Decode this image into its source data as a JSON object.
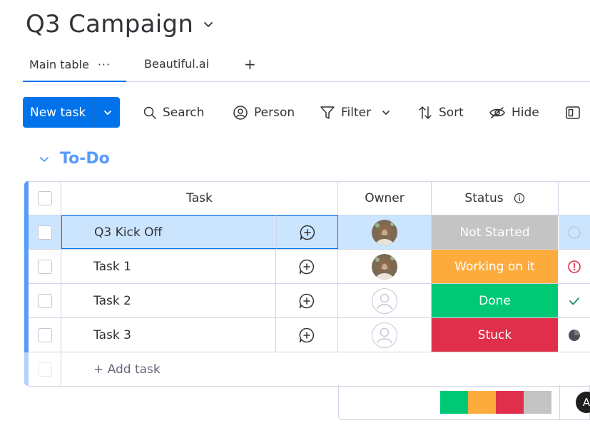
{
  "board": {
    "title": "Q3 Campaign"
  },
  "views": {
    "main": "Main table",
    "main_more": "···",
    "second": "Beautiful.ai",
    "add": "+"
  },
  "toolbar": {
    "new_task": "New task",
    "search": "Search",
    "person": "Person",
    "filter": "Filter",
    "sort": "Sort",
    "hide": "Hide"
  },
  "group": {
    "title": "To-Do",
    "color": "#579bfc"
  },
  "table": {
    "headers": {
      "task": "Task",
      "owner": "Owner",
      "status": "Status"
    },
    "rows": [
      {
        "name": "Q3 Kick Off",
        "owner": "photo",
        "status": "Not Started",
        "status_color": "#c4c4c4",
        "extra_icon": "circle-outline-icon"
      },
      {
        "name": "Task 1",
        "owner": "photo",
        "status": "Working on it",
        "status_color": "#fdab3d",
        "extra_icon": "alert-circle-icon"
      },
      {
        "name": "Task 2",
        "owner": "empty",
        "status": "Done",
        "status_color": "#00c875",
        "extra_icon": "checkmark-icon"
      },
      {
        "name": "Task 3",
        "owner": "empty",
        "status": "Stuck",
        "status_color": "#df2f4a",
        "extra_icon": "pie-progress-icon"
      }
    ],
    "add_task": "+ Add task"
  },
  "summary": {
    "distribution": [
      "#00c875",
      "#fdab3d",
      "#df2f4a",
      "#c4c4c4"
    ],
    "avatar_letter": "A"
  },
  "colors": {
    "primary": "#0073ea",
    "border": "#d0d4e4",
    "selected": "#cce5ff"
  }
}
